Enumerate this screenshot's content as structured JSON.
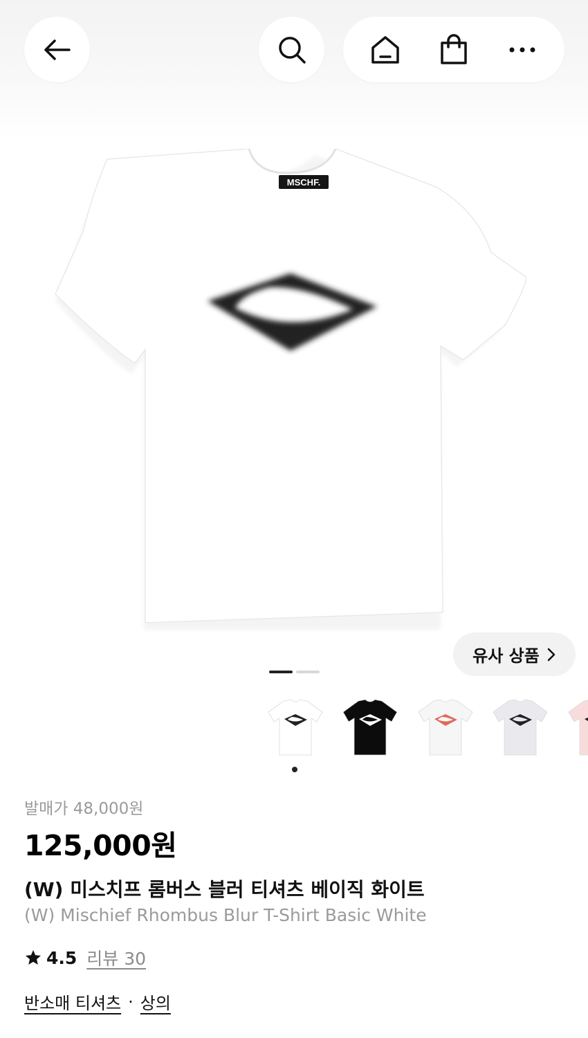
{
  "nav": {
    "back_icon": "arrow-left-icon",
    "search_icon": "search-icon",
    "home_icon": "home-icon",
    "cart_icon": "shopping-bag-icon",
    "more_icon": "more-horizontal-icon"
  },
  "product_image": {
    "brand_tag": "MSCHF."
  },
  "similar_button": {
    "label": "유사 상품",
    "icon": "chevron-right-icon"
  },
  "carousel": {
    "current_page": 1,
    "total_pages": 2
  },
  "color_options": {
    "thumbnails": [
      {
        "shirt_color": "#ffffff",
        "graphic_color": "#222222"
      },
      {
        "shirt_color": "#0c0c0c",
        "graphic_color": "#ffffff"
      },
      {
        "shirt_color": "#f6f6f6",
        "graphic_color": "#e06a5a"
      },
      {
        "shirt_color": "#e9e9ee",
        "graphic_color": "#222222"
      },
      {
        "shirt_color": "#f8dcdc",
        "graphic_color": "#222222"
      }
    ],
    "selected_index": 0
  },
  "pricing": {
    "release_price": "발매가 48,000원",
    "price": "125,000원"
  },
  "title": {
    "korean": "(W) 미스치프 롬버스 블러 티셔츠 베이직 화이트",
    "english": "(W) Mischief Rhombus Blur T-Shirt Basic White"
  },
  "rating": {
    "star_icon": "star-icon",
    "score": "4.5",
    "reviews": "리뷰 30"
  },
  "categories": {
    "primary": "반소매 티셔츠",
    "separator": "·",
    "secondary": "상의"
  },
  "colors": {
    "accent": "#111111",
    "muted": "#9a9a9a"
  }
}
